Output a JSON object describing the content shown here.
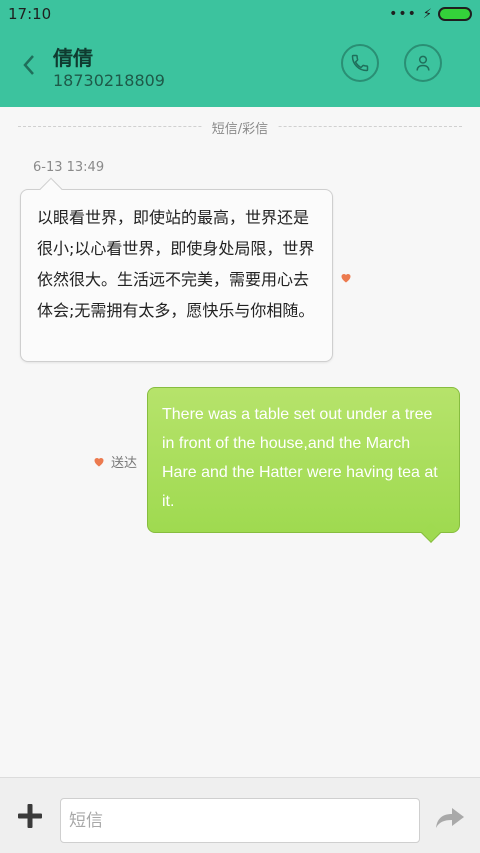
{
  "status_bar": {
    "time": "17:10"
  },
  "header": {
    "contact_name": "倩倩",
    "contact_number": "18730218809",
    "icons": [
      "back-icon",
      "phone-icon",
      "person-icon"
    ],
    "accent_color": "#3cc39e"
  },
  "conversation": {
    "divider_label": "短信/彩信",
    "messages": [
      {
        "direction": "incoming",
        "timestamp": "6-13 13:49",
        "text": "以眼看世界，即使站的最高，世界还是很小;以心看世界，即使身处局限，世界依然很大。生活远不完美，需要用心去体会;无需拥有太多，愿快乐与你相随。"
      },
      {
        "direction": "outgoing",
        "status": "送达",
        "text": "There was a table set out under a tree in front of the house,and the March Hare and the Hatter were having tea at it."
      }
    ]
  },
  "composer": {
    "placeholder": "短信",
    "value": ""
  }
}
